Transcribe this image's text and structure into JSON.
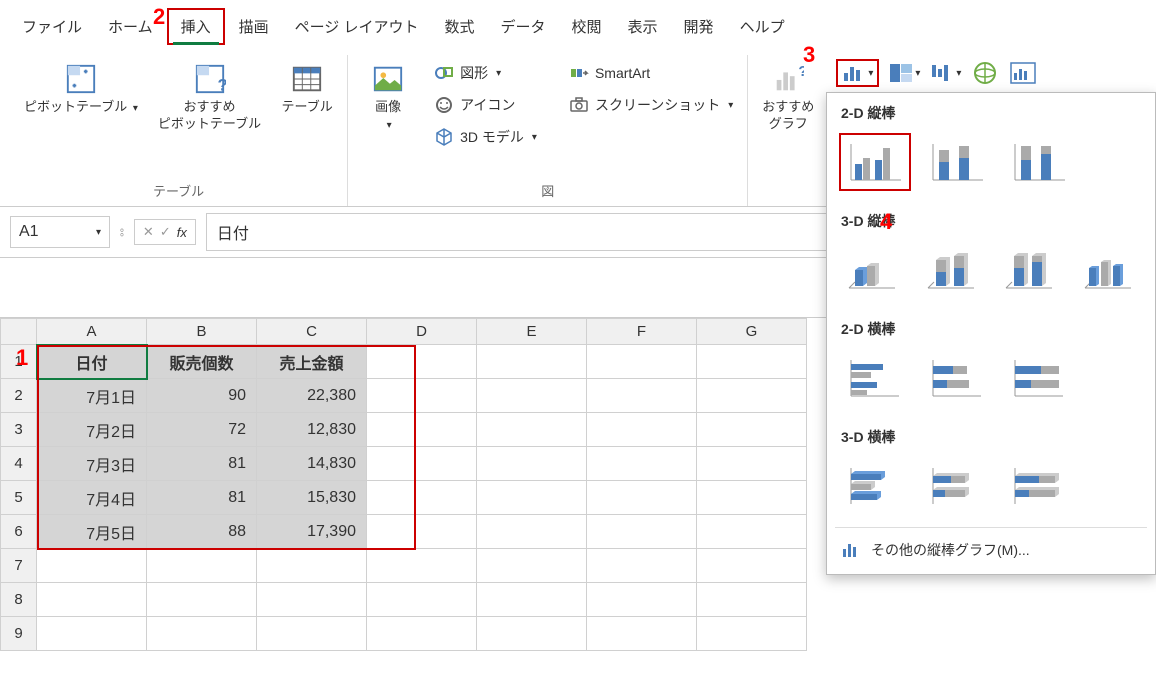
{
  "menu": {
    "items": [
      "ファイル",
      "ホーム",
      "挿入",
      "描画",
      "ページ レイアウト",
      "数式",
      "データ",
      "校閲",
      "表示",
      "開発",
      "ヘルプ"
    ],
    "active_index": 2
  },
  "ribbon": {
    "tables": {
      "pivot": "ピボットテーブル",
      "recommended_pivot": "おすすめ\nピボットテーブル",
      "table": "テーブル",
      "group_label": "テーブル"
    },
    "illustrations": {
      "pictures": "画像",
      "shapes": "図形",
      "icons": "アイコン",
      "models3d": "3D モデル",
      "smartart": "SmartArt",
      "screenshot": "スクリーンショット",
      "group_label": "図"
    },
    "charts": {
      "recommended": "おすすめ\nグラフ"
    }
  },
  "namebox": "A1",
  "formula": "日付",
  "sheet": {
    "cols": [
      "A",
      "B",
      "C",
      "D",
      "E",
      "F",
      "G"
    ],
    "headers": [
      "日付",
      "販売個数",
      "売上金額"
    ],
    "rows": [
      {
        "date": "7月1日",
        "qty": "90",
        "amount": "22,380"
      },
      {
        "date": "7月2日",
        "qty": "72",
        "amount": "12,830"
      },
      {
        "date": "7月3日",
        "qty": "81",
        "amount": "14,830"
      },
      {
        "date": "7月4日",
        "qty": "81",
        "amount": "15,830"
      },
      {
        "date": "7月5日",
        "qty": "88",
        "amount": "17,390"
      }
    ],
    "row_count": 9
  },
  "gallery": {
    "section_2d_col": "2-D 縦棒",
    "section_3d_col": "3-D 縦棒",
    "section_2d_bar": "2-D 横棒",
    "section_3d_bar": "3-D 横棒",
    "more": "その他の縦棒グラフ(M)..."
  },
  "callouts": {
    "c1": "1",
    "c2": "2",
    "c3": "3",
    "c4": "4"
  }
}
